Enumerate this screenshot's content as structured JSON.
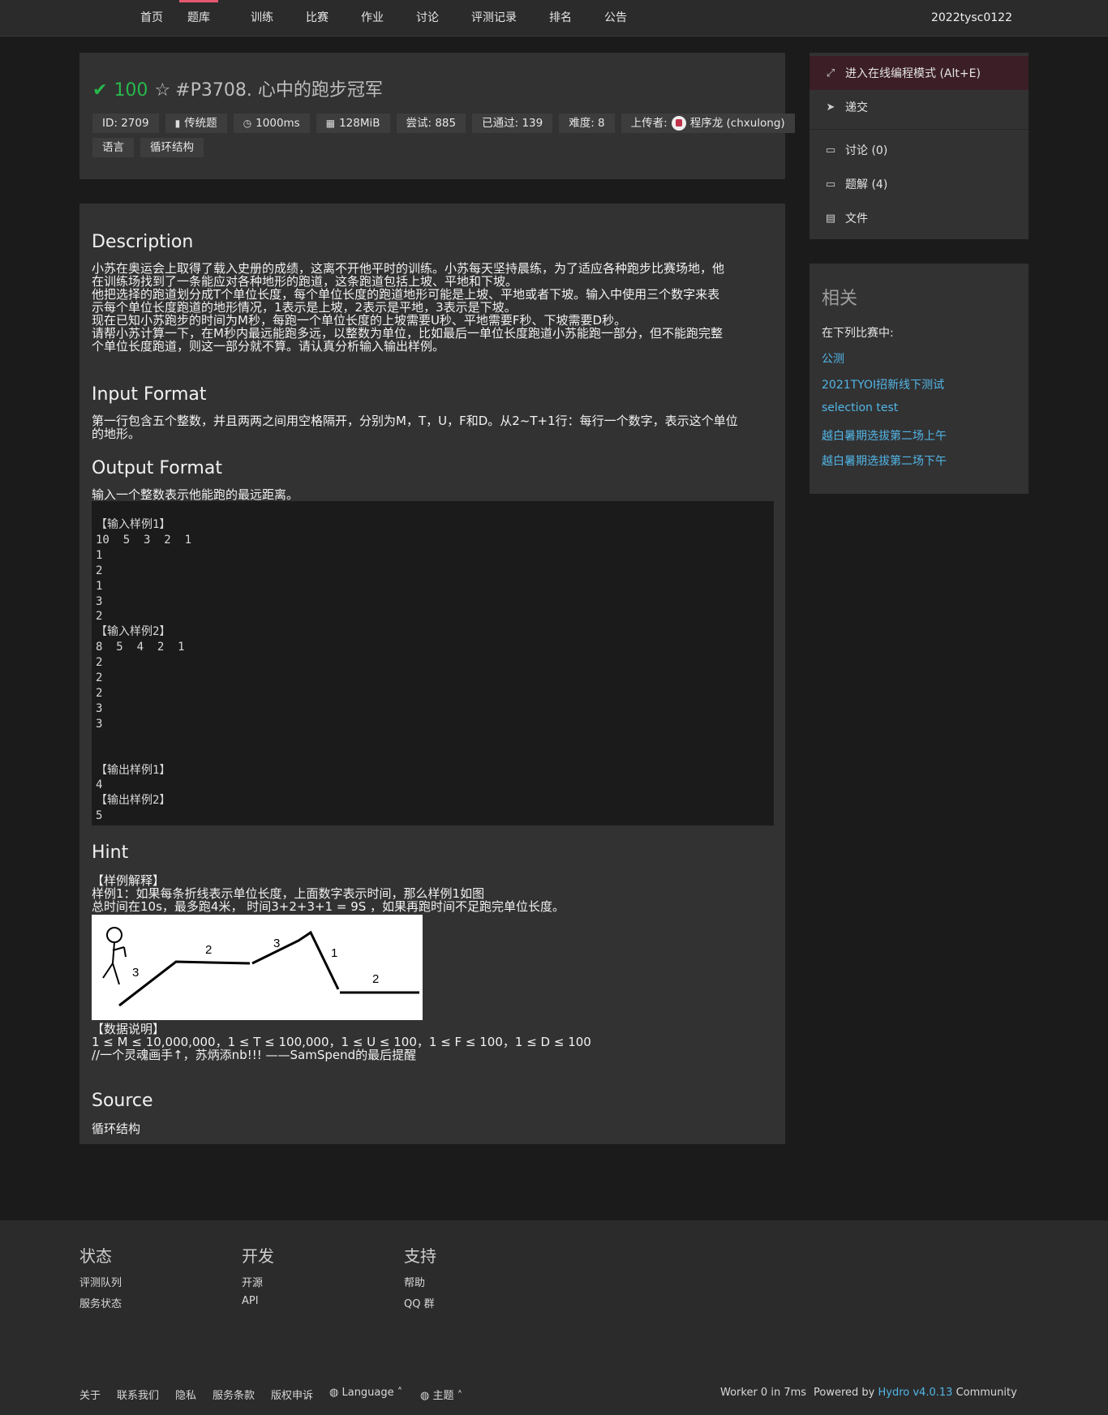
{
  "nav": {
    "items": [
      "首页",
      "题库",
      "训练",
      "比赛",
      "作业",
      "讨论",
      "评测记录",
      "排名",
      "公告"
    ],
    "active_index": 1,
    "user": "2022tysc0122"
  },
  "problem": {
    "score": "100",
    "title": "#P3708. 心中的跑步冠军",
    "meta": {
      "id": "ID: 2709",
      "type": "传统题",
      "time": "1000ms",
      "memory": "128MiB",
      "attempts": "尝试: 885",
      "accepted": "已通过: 139",
      "difficulty": "难度: 8",
      "uploader_label": "上传者:",
      "uploader": "程序龙 (chxulong)"
    },
    "tags": [
      "语言",
      "循环结构"
    ]
  },
  "content": {
    "description_heading": "Description",
    "description_lines": [
      "小苏在奥运会上取得了载入史册的成绩，这离不开他平时的训练。小苏每天坚持晨练，为了适应各种跑步比赛场地，他",
      "在训练场找到了一条能应对各种地形的跑道，这条跑道包括上坡、平地和下坡。",
      "他把选择的跑道划分成T个单位长度，每个单位长度的跑道地形可能是上坡、平地或者下坡。输入中使用三个数字来表",
      "示每个单位长度跑道的地形情况，1表示是上坡，2表示是平地，3表示是下坡。",
      "现在已知小苏跑步的时间为M秒，每跑一个单位长度的上坡需要U秒、平地需要F秒、下坡需要D秒。",
      "请帮小苏计算一下，在M秒内最远能跑多远，以整数为单位，比如最后一单位长度跑道小苏能跑一部分，但不能跑完整",
      "个单位长度跑道，则这一部分就不算。请认真分析输入输出样例。"
    ],
    "input_heading": "Input Format",
    "input_lines": [
      "第一行包含五个整数，并且两两之间用空格隔开，分别为M，T，U，F和D。从2~T+1行：每行一个数字，表示这个单位",
      "的地形。"
    ],
    "output_heading": "Output Format",
    "output_line": "输入一个整数表示他能跑的最远距离。",
    "sample_block": "【输入样例1】\n10  5  3  2  1\n1\n2\n1\n3\n2\n【输入样例2】\n8  5  4  2  1\n2\n2\n2\n3\n3\n\n\n【输出样例1】\n4\n【输出样例2】\n5",
    "hint_heading": "Hint",
    "hint_lines": [
      "【样例解释】",
      "样例1：如果每条折线表示单位长度，上面数字表示时间，那么样例1如图",
      "总时间在10s，最多跑4米， 时间3+2+3+1 = 9S ，如果再跑时间不足跑完单位长度。"
    ],
    "sketch_labels": [
      "3",
      "2",
      "3",
      "1",
      "2"
    ],
    "data_lines": [
      "【数据说明】",
      "1 ≤ M ≤ 10,000,000，1 ≤ T ≤ 100,000，1 ≤ U ≤ 100，1 ≤ F ≤ 100，1 ≤ D ≤ 100",
      "//一个灵魂画手↑，苏炳添nb!!! ——SamSpend的最后提醒"
    ],
    "source_heading": "Source",
    "source_value": "循环结构"
  },
  "sidebar": {
    "actions": [
      {
        "label": "进入在线编程模式 (Alt+E)",
        "icon": "expand-icon"
      },
      {
        "label": "递交",
        "icon": "send-icon"
      },
      {
        "label": "讨论 (0)",
        "icon": "comment-icon"
      },
      {
        "label": "题解 (4)",
        "icon": "comment-icon"
      },
      {
        "label": "文件",
        "icon": "file-icon"
      }
    ],
    "related_title": "相关",
    "related_sub": "在下列比赛中:",
    "related_links": [
      "公测",
      "2021TYOI招新线下测试",
      "selection test",
      "越白暑期选拔第二场上午",
      "越白暑期选拔第二场下午"
    ]
  },
  "footer": {
    "columns": [
      {
        "title": "状态",
        "links": [
          "评测队列",
          "服务状态"
        ]
      },
      {
        "title": "开发",
        "links": [
          "开源",
          "API"
        ]
      },
      {
        "title": "支持",
        "links": [
          "帮助",
          "QQ 群"
        ]
      }
    ],
    "bottom_links": [
      "关于",
      "联系我们",
      "隐私",
      "服务条款",
      "版权申诉"
    ],
    "language_label": "Language",
    "theme_label": "主题",
    "worker": "Worker 0 in 7ms",
    "powered_prefix": "Powered by",
    "powered_name": "Hydro v4.0.13",
    "powered_suffix": "Community"
  },
  "colors": {
    "accent_pink": "#e4596f",
    "accepted_green": "#28b84a",
    "link_blue": "#52b6e6"
  }
}
